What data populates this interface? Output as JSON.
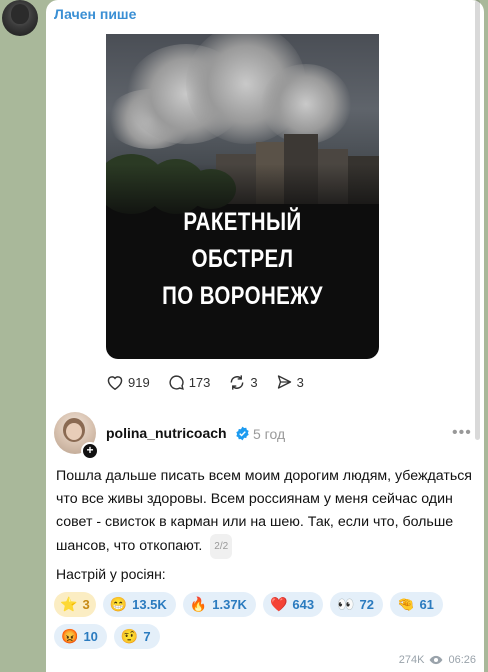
{
  "channel": {
    "name": "Лачен пише"
  },
  "post_image": {
    "title_line1": "РАКЕТНЫЙ ОБСТРЕЛ",
    "title_line2": "ПО ВОРОНЕЖУ"
  },
  "post_stats": {
    "likes": "919",
    "comments": "173",
    "reposts": "3",
    "shares": "3"
  },
  "threads_author": {
    "username": "polina_nutricoach",
    "time_ago": "5 год",
    "more": "•••"
  },
  "message": {
    "text": "Пошла дальше писать всем моим дорогим людям, убеждаться что все живы здоровы. Всем россиянам у меня сейчас один совет - свисток в карман или на шею. Так, если что, больше шансов, что откопают.",
    "page": "2/2",
    "mood_label": "Настрій у росіян:"
  },
  "reactions": [
    {
      "emoji": "⭐",
      "count": "3",
      "kind": "star"
    },
    {
      "emoji": "😁",
      "count": "13.5K"
    },
    {
      "emoji": "🔥",
      "count": "1.37K"
    },
    {
      "emoji": "❤️",
      "count": "643"
    },
    {
      "emoji": "👀",
      "count": "72"
    },
    {
      "emoji": "🤏",
      "count": "61"
    },
    {
      "emoji": "😡",
      "count": "10"
    },
    {
      "emoji": "🤨",
      "count": "7"
    }
  ],
  "footer": {
    "views": "274K",
    "time": "06:26"
  },
  "colors": {
    "accent": "#3a8fd4",
    "reaction_bg": "#e4eff9",
    "wallpaper": "#a9b89a"
  }
}
